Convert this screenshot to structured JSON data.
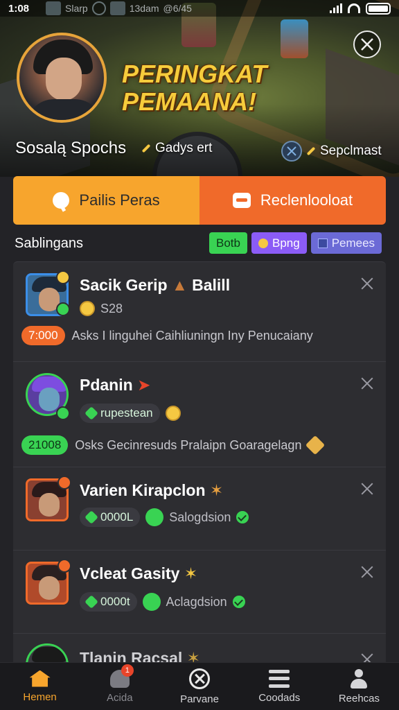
{
  "status_bar": {
    "time": "1:08",
    "mini_label": "Slarp",
    "mini_time": "13dam",
    "mini_count": "@6/45"
  },
  "hero": {
    "title_line1": "PERINGKAT",
    "title_line2": "PEMAANA!",
    "player_name": "Sosalą Spochs",
    "player_sub": "Gadys ert",
    "right_label": "Sepclmast"
  },
  "actions": {
    "primary_label": "Pailis Peras",
    "secondary_label": "Reclenlooloat"
  },
  "section": {
    "title": "Sablingans",
    "chips": [
      {
        "label": "Botb",
        "color": "#39d353"
      },
      {
        "label": "Bpng",
        "color": "#8b5cf6"
      },
      {
        "label": "Pemees",
        "color": "#6b6ad6"
      }
    ]
  },
  "list": [
    {
      "name": "Sacik Gerip",
      "name_suffix": "Balill",
      "meta_value": "S28",
      "score": "7:000",
      "description": "Asks I linguhei Caihliuningn Iny Penucaiany"
    },
    {
      "name": "Pdanin",
      "tag": "rupestean",
      "score": "21008",
      "description": "Osks Gecinresuds Pralaipn  Goaragelagn"
    },
    {
      "name": "Varien Kirapclon",
      "pill": "0000L",
      "status": "Salogdsion"
    },
    {
      "name": "Vcleat Gasity",
      "pill": "0000t",
      "status": "Aclagdsion"
    },
    {
      "name": "Tlanin Racsal"
    }
  ],
  "bottom_nav": [
    {
      "label": "Hemen",
      "icon": "home-icon",
      "active": true
    },
    {
      "label": "Acida",
      "icon": "people-icon",
      "badge": "1"
    },
    {
      "label": "Parvane",
      "icon": "close-circle-icon"
    },
    {
      "label": "Coodads",
      "icon": "list-icon"
    },
    {
      "label": "Reehcas",
      "icon": "user-icon"
    }
  ],
  "colors": {
    "accent_orange": "#f7a52d",
    "accent_red": "#f06a2a",
    "accent_green": "#39d353",
    "gold_title": "#f6cc3c"
  }
}
